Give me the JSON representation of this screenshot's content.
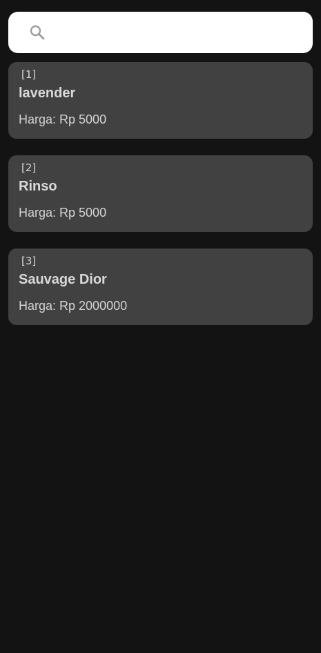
{
  "search": {
    "placeholder": "",
    "value": "",
    "icon": "search-icon"
  },
  "items": [
    {
      "id_label": "[1]",
      "name": "lavender",
      "price": "Harga: Rp 5000"
    },
    {
      "id_label": "[2]",
      "name": "Rinso",
      "price": "Harga: Rp 5000"
    },
    {
      "id_label": "[3]",
      "name": "Sauvage Dior",
      "price": "Harga: Rp 2000000"
    }
  ],
  "colors": {
    "background": "#131313",
    "card": "#414141",
    "search_bg": "#ffffff",
    "text": "#d9d9d9"
  }
}
